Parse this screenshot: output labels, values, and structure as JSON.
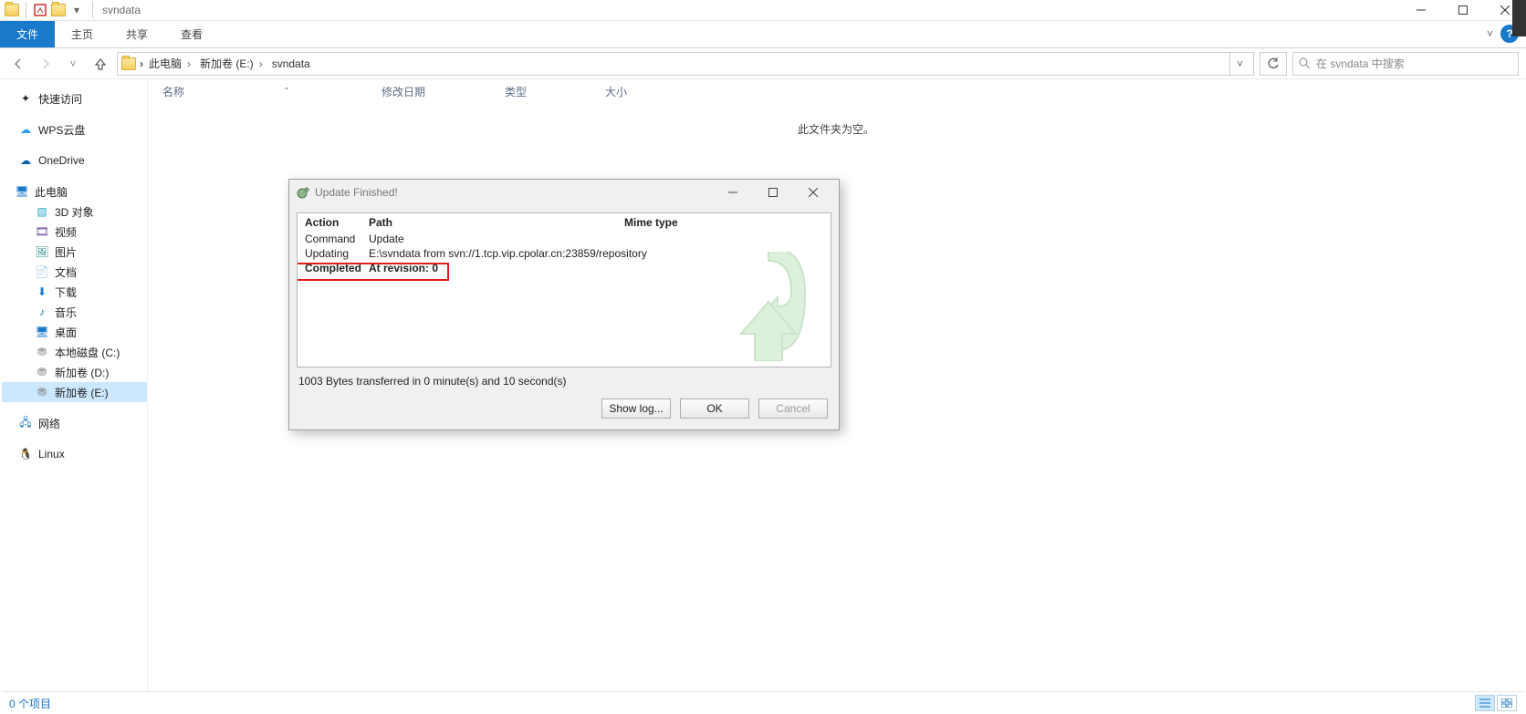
{
  "window": {
    "title": "svndata"
  },
  "ribbon": {
    "file": "文件",
    "home": "主页",
    "share": "共享",
    "view": "查看"
  },
  "nav": {
    "back": "←",
    "forward": "→",
    "up": "↑"
  },
  "breadcrumb": [
    {
      "label": "此电脑"
    },
    {
      "label": "新加卷 (E:)"
    },
    {
      "label": "svndata"
    }
  ],
  "search": {
    "placeholder": "在 svndata 中搜索"
  },
  "tree": {
    "quick": "快速访问",
    "wps": "WPS云盘",
    "onedrive": "OneDrive",
    "thispc": "此电脑",
    "obj3d": "3D 对象",
    "videos": "视频",
    "pictures": "图片",
    "docs": "文档",
    "downloads": "下载",
    "music": "音乐",
    "desktop": "桌面",
    "cdrive": "本地磁盘 (C:)",
    "ddrive": "新加卷 (D:)",
    "edrive": "新加卷 (E:)",
    "network": "网络",
    "linux": "Linux"
  },
  "columns": {
    "name": "名称",
    "modified": "修改日期",
    "type": "类型",
    "size": "大小"
  },
  "content": {
    "empty": "此文件夹为空。"
  },
  "status": {
    "count": "0 个项目"
  },
  "dialog": {
    "title": "Update Finished!",
    "head": {
      "action": "Action",
      "path": "Path",
      "mime": "Mime type"
    },
    "rows": [
      {
        "action": "Command",
        "path": "Update"
      },
      {
        "action": "Updating",
        "path": "E:\\svndata from svn://1.tcp.vip.cpolar.cn:23859/repository"
      },
      {
        "action": "Completed",
        "path": "At revision: 0",
        "bold": true
      }
    ],
    "summary": "1003 Bytes transferred in 0 minute(s) and 10 second(s)",
    "buttons": {
      "showlog": "Show log...",
      "ok": "OK",
      "cancel": "Cancel"
    }
  }
}
